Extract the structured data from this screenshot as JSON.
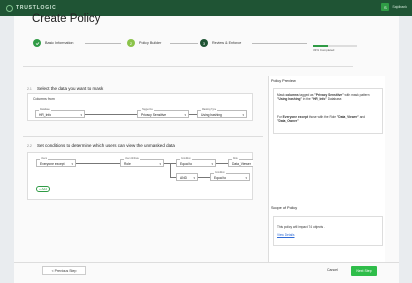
{
  "app": {
    "brand": "TRUSTLOGIC",
    "user": "Sajdbank",
    "avatar_initial": "S",
    "accent": "#2f9b45"
  },
  "page": {
    "title": "Create Policy"
  },
  "stepper": {
    "steps": [
      {
        "label": "Basic Information",
        "state": "done",
        "icon": "check-icon"
      },
      {
        "label": "Policy Builder",
        "state": "active",
        "number": "2"
      },
      {
        "label": "Review & Enforce",
        "state": "pending",
        "number": "3"
      }
    ],
    "progress_label": "33% Completed",
    "progress_fraction": 0.33
  },
  "section1": {
    "number": "2.1",
    "title": "Select the data you want to mask",
    "columns_label": "Columns from",
    "database": {
      "caption": "Database",
      "value": "HR_Info"
    },
    "tagged_as": {
      "caption": "Tagged As",
      "value": "Privacy Sensitive"
    },
    "masking_type": {
      "caption": "Masking Type",
      "value": "Using hashing"
    }
  },
  "section2": {
    "number": "2.2",
    "title": "Set conditions to determine which users can view the unmasked data",
    "row1": [
      {
        "caption": "Users",
        "value": "Everyone except"
      },
      {
        "caption": "User Attribute",
        "value": "Role"
      },
      {
        "caption": "Condition",
        "value": "Equal to"
      },
      {
        "caption": "Role",
        "value": "Data_Viewer"
      }
    ],
    "row2": [
      {
        "caption": "",
        "value": "AND"
      },
      {
        "caption": "Condition",
        "value": "Equal to"
      }
    ],
    "add_label": "+ Add"
  },
  "preview": {
    "title": "Policy Preview",
    "para1": {
      "a": "Mask ",
      "b": "columns",
      "c": " tagged as ",
      "d": "\"Privacy Sensitive\"",
      "e": " with mask pattern ",
      "f": "\"Using hashing\"",
      "g": " in the ",
      "h": "\"HR_Info\"",
      "i": " Database."
    },
    "para2": {
      "a": "For ",
      "b": "Everyone except",
      "c": " those with the Role ",
      "d": "\"Data_Viewer\"",
      "e": " and ",
      "f": "\"Data_Owner\""
    }
  },
  "scope": {
    "title": "Scope of Policy",
    "text": "This policy will impact 74 objects .",
    "link": "View Details"
  },
  "footer": {
    "previous": "< Previous Step",
    "cancel": "Cancel",
    "save": "Next Step"
  }
}
